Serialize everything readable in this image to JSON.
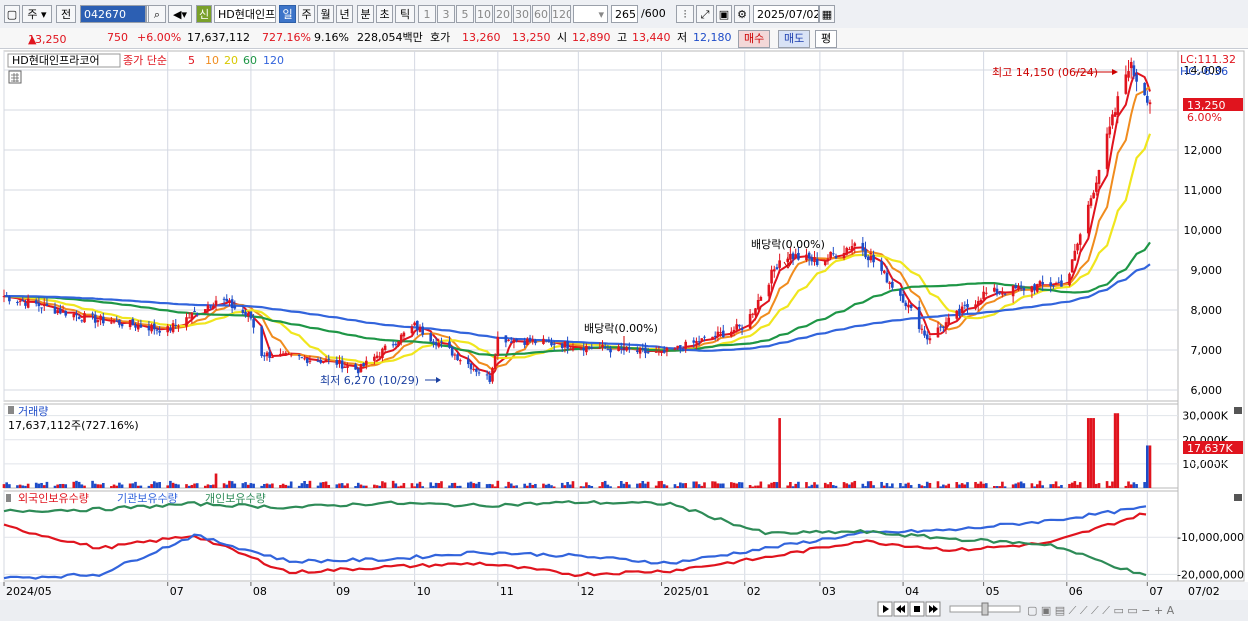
{
  "toolbar": {
    "period_type": "주",
    "prev_label": "전",
    "code": "042670",
    "credit_label": "신",
    "stock_name": "HD현대인프",
    "periods": [
      "일",
      "주",
      "월",
      "년",
      "분",
      "초",
      "틱"
    ],
    "active_period": "일",
    "intervals": [
      "1",
      "3",
      "5",
      "10",
      "20",
      "30",
      "60",
      "120"
    ],
    "count": "265",
    "count_max": "/600",
    "date": "2025/07/02"
  },
  "status_bar": {
    "price": "13,250",
    "change": "750",
    "change_pct": "+6.00%",
    "volume": "17,637,112",
    "volume_ratio": "727.16%",
    "turnover": "9.16%",
    "trade_value": "228,054백만",
    "quote_label": "호가",
    "ask": "13,260",
    "bid": "13,250",
    "open_label": "시",
    "open": "12,890",
    "high_label": "고",
    "high": "13,440",
    "low_label": "저",
    "low": "12,180",
    "buy_label": "매수",
    "sell_label": "매도",
    "eval_label": "평"
  },
  "colors": {
    "up": "#e0141e",
    "down": "#1e4cc8",
    "ma5": "#e0141e",
    "ma10": "#f08c1e",
    "ma20": "#f0e61e",
    "ma60": "#1e9646",
    "ma120": "#3264dc",
    "foreign": "#e0141e",
    "institution": "#3264dc",
    "individual": "#2e8b57"
  },
  "price_panel": {
    "name": "HD현대인프라코어",
    "legend_label": "종가 단순",
    "ma_periods": [
      "5",
      "10",
      "20",
      "60",
      "120"
    ],
    "lc_label": "LC:111.32",
    "hc_label": "HC:-6.36",
    "current_price_tag": "13,250",
    "current_pct_tag": "6.00%",
    "annotation_high": "최고 14,150 (06/24)",
    "annotation_low": "최저 6,270 (10/29)",
    "annotation_div1": "배당락(0.00%)",
    "annotation_div2": "배당락(0.00%)"
  },
  "volume_panel": {
    "title": "거래량",
    "value_label": "17,637,112주(727.16%)",
    "current_tag": "17,637K",
    "current_pct": "727.16%"
  },
  "holdings_panel": {
    "series_labels": [
      "외국인보유수량",
      "기관보유수량",
      "개인보유수량"
    ]
  },
  "x_axis_labels": [
    "2024/05",
    "07",
    "08",
    "09",
    "10",
    "11",
    "12",
    "2025/01",
    "02",
    "03",
    "04",
    "05",
    "06",
    "07"
  ],
  "x_axis_right_label": "07/02",
  "chart_data": [
    {
      "type": "candlestick",
      "title": "HD현대인프라코어",
      "ylim": [
        5800,
        14400
      ],
      "y_ticks": [
        6000,
        7000,
        8000,
        9000,
        10000,
        11000,
        12000,
        13000,
        14000
      ],
      "y_tick_labels": [
        "6,000",
        "7,000",
        "8,000",
        "9,000",
        "10,000",
        "11,000",
        "12,000",
        "",
        "14,000"
      ],
      "x_range": [
        "2024/05",
        "2025/07/02"
      ],
      "approx_close_path": [
        {
          "x": "2024/05",
          "y": 8350
        },
        {
          "x": "2024/06",
          "y": 7800
        },
        {
          "x": "2024/07",
          "y": 7500
        },
        {
          "x": "2024/07/20",
          "y": 8300
        },
        {
          "x": "2024/08",
          "y": 7800
        },
        {
          "x": "2024/08/05",
          "y": 6900
        },
        {
          "x": "2024/09",
          "y": 6700
        },
        {
          "x": "2024/09/10",
          "y": 6500
        },
        {
          "x": "2024/10",
          "y": 7600
        },
        {
          "x": "2024/10/29",
          "y": 6270
        },
        {
          "x": "2024/11",
          "y": 7300
        },
        {
          "x": "2024/12",
          "y": 7100
        },
        {
          "x": "2025/01",
          "y": 6900
        },
        {
          "x": "2025/02",
          "y": 7600
        },
        {
          "x": "2025/02/15",
          "y": 9400
        },
        {
          "x": "2025/03",
          "y": 9200
        },
        {
          "x": "2025/03/15",
          "y": 9700
        },
        {
          "x": "2025/04",
          "y": 8300
        },
        {
          "x": "2025/04/10",
          "y": 7300
        },
        {
          "x": "2025/05",
          "y": 8400
        },
        {
          "x": "2025/06",
          "y": 8700
        },
        {
          "x": "2025/06/24",
          "y": 14150
        },
        {
          "x": "2025/07/02",
          "y": 13250
        }
      ],
      "moving_averages": [
        "MA5",
        "MA10",
        "MA20",
        "MA60",
        "MA120"
      ],
      "annotations": [
        "최고 14,150 (06/24)",
        "최저 6,270 (10/29)",
        "배당락(0.00%)"
      ]
    },
    {
      "type": "bar",
      "title": "거래량",
      "ylim": [
        0,
        34000
      ],
      "y_ticks": [
        10000,
        20000,
        30000
      ],
      "y_tick_labels": [
        "10,000K",
        "20,000K",
        "30,000K"
      ],
      "last_value_k": 17637,
      "spikes_k": [
        {
          "x": "2024/07/20",
          "y": 6000
        },
        {
          "x": "2025/02/15",
          "y": 29000
        },
        {
          "x": "2025/06/10",
          "y": 29000
        },
        {
          "x": "2025/06/20",
          "y": 31000
        },
        {
          "x": "2025/07/02",
          "y": 17637
        }
      ]
    },
    {
      "type": "line",
      "title": "보유수량",
      "y_ticks": [
        -10000000,
        -20000000
      ],
      "y_tick_labels": [
        "-10,000,000",
        "-20,000,000"
      ],
      "series": [
        {
          "name": "외국인보유수량",
          "values": [
            -7000000,
            -13000000,
            -9500000,
            -19500000,
            -18000000,
            -17000000,
            -20000000,
            -19000000,
            -15500000,
            -11000000,
            -13500000,
            -11500000,
            -3500000
          ]
        },
        {
          "name": "기관보유수량",
          "values": [
            -21000000,
            -20000000,
            -9500000,
            -16500000,
            -16000000,
            -14000000,
            -15000000,
            -17000000,
            -13000000,
            -9000000,
            -8000000,
            -5500000,
            -2000000
          ]
        },
        {
          "name": "개인보유수량",
          "values": [
            -3000000,
            -2500000,
            -1000000,
            -2000000,
            -800000,
            -1500000,
            -600000,
            -1000000,
            -9000000,
            -8500000,
            -10500000,
            -12000000,
            -20500000
          ]
        }
      ]
    }
  ]
}
